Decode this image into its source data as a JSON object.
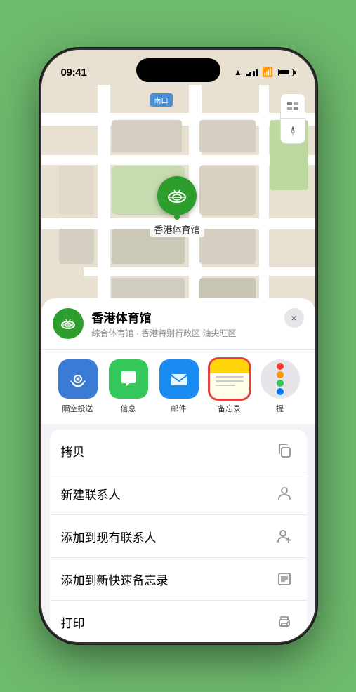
{
  "status_bar": {
    "time": "09:41",
    "location_indicator": "▲"
  },
  "map": {
    "label_south": "南口",
    "label_prefix": "南",
    "stadium_name": "香港体育馆",
    "stadium_emoji": "🏟"
  },
  "venue_card": {
    "name": "香港体育馆",
    "subtitle": "综合体育馆 · 香港特别行政区 油尖旺区",
    "close_label": "×"
  },
  "share_items": [
    {
      "id": "airdrop",
      "label": "隔空投送",
      "type": "airdrop"
    },
    {
      "id": "message",
      "label": "信息",
      "type": "message"
    },
    {
      "id": "mail",
      "label": "邮件",
      "type": "mail"
    },
    {
      "id": "notes",
      "label": "备忘录",
      "type": "notes"
    },
    {
      "id": "more",
      "label": "提",
      "type": "more"
    }
  ],
  "actions": [
    {
      "id": "copy",
      "label": "拷贝",
      "icon": "copy"
    },
    {
      "id": "new-contact",
      "label": "新建联系人",
      "icon": "person"
    },
    {
      "id": "add-contact",
      "label": "添加到现有联系人",
      "icon": "person-add"
    },
    {
      "id": "quick-note",
      "label": "添加到新快速备忘录",
      "icon": "note"
    },
    {
      "id": "print",
      "label": "打印",
      "icon": "print"
    }
  ]
}
